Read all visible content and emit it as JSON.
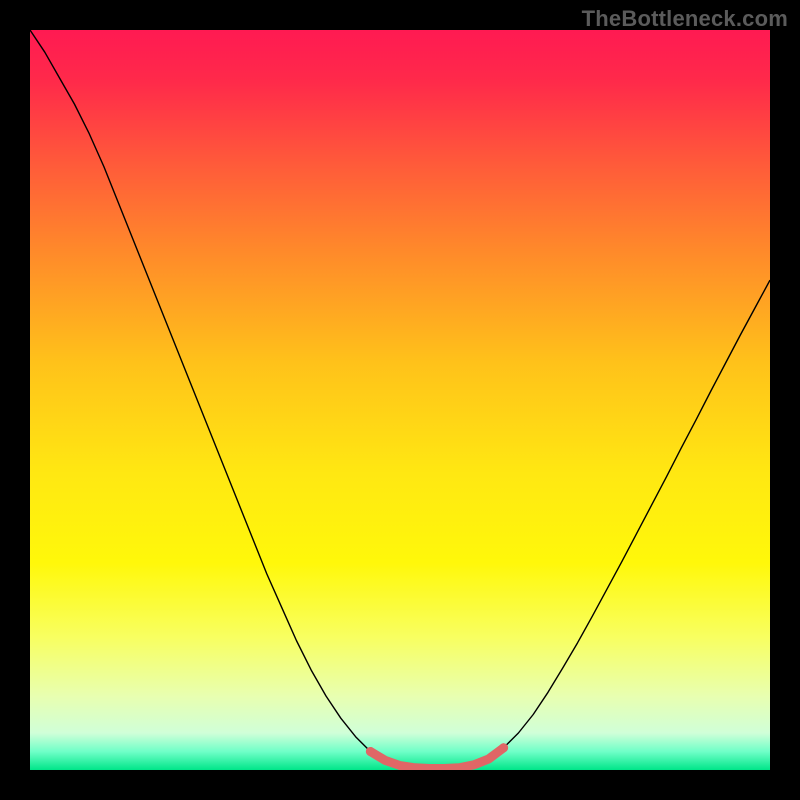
{
  "watermark": "TheBottleneck.com",
  "chart_data": {
    "type": "line",
    "title": "",
    "xlabel": "",
    "ylabel": "",
    "xlim": [
      0,
      100
    ],
    "ylim": [
      0,
      100
    ],
    "background_gradient": {
      "stops": [
        {
          "offset": 0.0,
          "color": "#ff1a52"
        },
        {
          "offset": 0.07,
          "color": "#ff2a4a"
        },
        {
          "offset": 0.18,
          "color": "#ff5a3a"
        },
        {
          "offset": 0.3,
          "color": "#ff8a2a"
        },
        {
          "offset": 0.45,
          "color": "#ffc21a"
        },
        {
          "offset": 0.6,
          "color": "#ffe812"
        },
        {
          "offset": 0.72,
          "color": "#fff80a"
        },
        {
          "offset": 0.82,
          "color": "#f8ff60"
        },
        {
          "offset": 0.9,
          "color": "#e8ffb0"
        },
        {
          "offset": 0.95,
          "color": "#d0ffd8"
        },
        {
          "offset": 0.975,
          "color": "#70ffc8"
        },
        {
          "offset": 1.0,
          "color": "#00e689"
        }
      ]
    },
    "series": [
      {
        "name": "bottleneck-curve",
        "color": "#000000",
        "width": 1.4,
        "points": [
          {
            "x": 0.0,
            "y": 100.0
          },
          {
            "x": 2.0,
            "y": 97.0
          },
          {
            "x": 4.0,
            "y": 93.5
          },
          {
            "x": 6.0,
            "y": 90.0
          },
          {
            "x": 8.0,
            "y": 86.0
          },
          {
            "x": 10.0,
            "y": 81.5
          },
          {
            "x": 12.0,
            "y": 76.5
          },
          {
            "x": 14.0,
            "y": 71.5
          },
          {
            "x": 16.0,
            "y": 66.5
          },
          {
            "x": 18.0,
            "y": 61.5
          },
          {
            "x": 20.0,
            "y": 56.5
          },
          {
            "x": 22.0,
            "y": 51.5
          },
          {
            "x": 24.0,
            "y": 46.5
          },
          {
            "x": 26.0,
            "y": 41.5
          },
          {
            "x": 28.0,
            "y": 36.5
          },
          {
            "x": 30.0,
            "y": 31.5
          },
          {
            "x": 32.0,
            "y": 26.5
          },
          {
            "x": 34.0,
            "y": 22.0
          },
          {
            "x": 36.0,
            "y": 17.5
          },
          {
            "x": 38.0,
            "y": 13.5
          },
          {
            "x": 40.0,
            "y": 10.0
          },
          {
            "x": 42.0,
            "y": 7.0
          },
          {
            "x": 44.0,
            "y": 4.5
          },
          {
            "x": 46.0,
            "y": 2.5
          },
          {
            "x": 48.0,
            "y": 1.3
          },
          {
            "x": 50.0,
            "y": 0.6
          },
          {
            "x": 52.0,
            "y": 0.3
          },
          {
            "x": 54.0,
            "y": 0.2
          },
          {
            "x": 56.0,
            "y": 0.2
          },
          {
            "x": 58.0,
            "y": 0.3
          },
          {
            "x": 60.0,
            "y": 0.7
          },
          {
            "x": 62.0,
            "y": 1.5
          },
          {
            "x": 64.0,
            "y": 3.0
          },
          {
            "x": 66.0,
            "y": 5.0
          },
          {
            "x": 68.0,
            "y": 7.5
          },
          {
            "x": 70.0,
            "y": 10.5
          },
          {
            "x": 72.0,
            "y": 13.8
          },
          {
            "x": 74.0,
            "y": 17.2
          },
          {
            "x": 76.0,
            "y": 20.8
          },
          {
            "x": 78.0,
            "y": 24.5
          },
          {
            "x": 80.0,
            "y": 28.2
          },
          {
            "x": 82.0,
            "y": 32.0
          },
          {
            "x": 84.0,
            "y": 35.8
          },
          {
            "x": 86.0,
            "y": 39.6
          },
          {
            "x": 88.0,
            "y": 43.5
          },
          {
            "x": 90.0,
            "y": 47.3
          },
          {
            "x": 92.0,
            "y": 51.2
          },
          {
            "x": 94.0,
            "y": 55.0
          },
          {
            "x": 96.0,
            "y": 58.8
          },
          {
            "x": 98.0,
            "y": 62.5
          },
          {
            "x": 100.0,
            "y": 66.2
          }
        ]
      },
      {
        "name": "optimal-band",
        "color": "#e06666",
        "width": 9,
        "linecap": "round",
        "points": [
          {
            "x": 46.0,
            "y": 2.5
          },
          {
            "x": 48.0,
            "y": 1.3
          },
          {
            "x": 50.0,
            "y": 0.6
          },
          {
            "x": 52.0,
            "y": 0.3
          },
          {
            "x": 54.0,
            "y": 0.2
          },
          {
            "x": 56.0,
            "y": 0.2
          },
          {
            "x": 58.0,
            "y": 0.3
          },
          {
            "x": 60.0,
            "y": 0.7
          },
          {
            "x": 62.0,
            "y": 1.5
          },
          {
            "x": 64.0,
            "y": 3.0
          }
        ]
      }
    ]
  }
}
